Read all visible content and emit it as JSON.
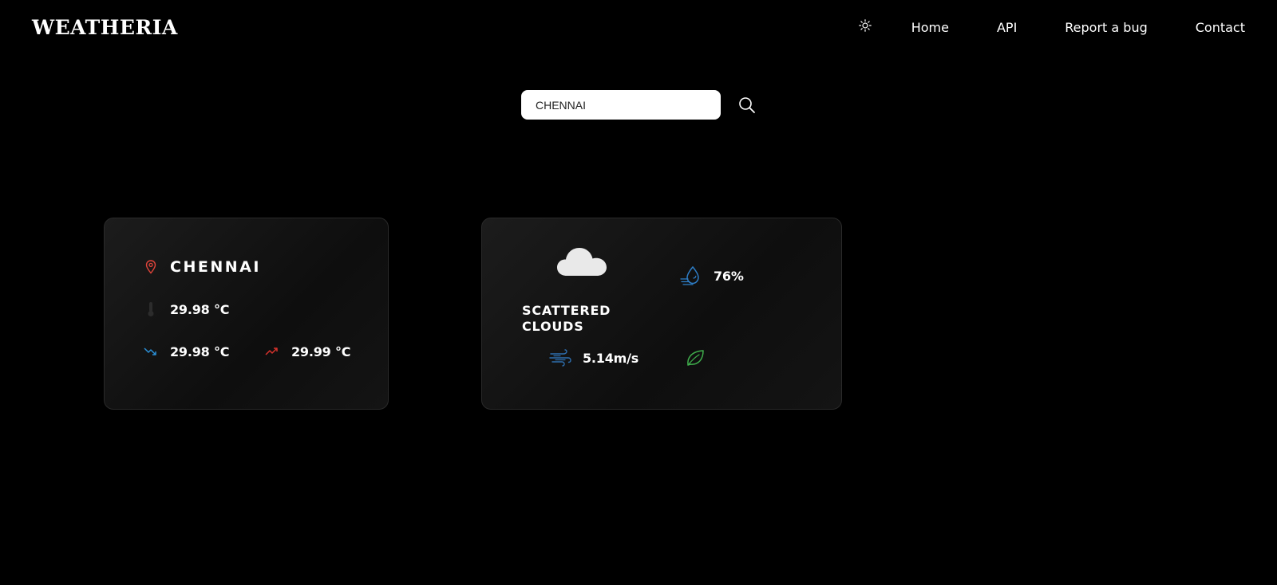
{
  "header": {
    "logo": "WEATHERIA",
    "theme_icon": "sun-icon",
    "nav": {
      "home": "Home",
      "api": "API",
      "report": "Report a bug",
      "contact": "Contact"
    }
  },
  "search": {
    "value": "CHENNAI",
    "placeholder": "",
    "icon": "search-icon"
  },
  "location_card": {
    "city": "CHENNAI",
    "temp": "29.98 °C",
    "temp_min": "29.98 °C",
    "temp_max": "29.99 °C",
    "icons": {
      "location": "location-pin-icon",
      "temp": "thermometer-icon",
      "min": "trend-down-icon",
      "max": "trend-up-icon"
    }
  },
  "conditions_card": {
    "description": "SCATTERED CLOUDS",
    "humidity": "76%",
    "wind": "5.14m/s",
    "icons": {
      "condition": "cloud-icon",
      "humidity": "humidity-icon",
      "wind": "wind-icon",
      "air": "leaf-icon"
    }
  },
  "colors": {
    "background": "#000000",
    "card_border": "#2a2a2a",
    "pin": "#e0443a",
    "trend_down": "#2b8fd6",
    "trend_up": "#d8322c",
    "humidity": "#2e7fc9",
    "wind": "#2e6fb0",
    "leaf": "#3fae4c"
  }
}
